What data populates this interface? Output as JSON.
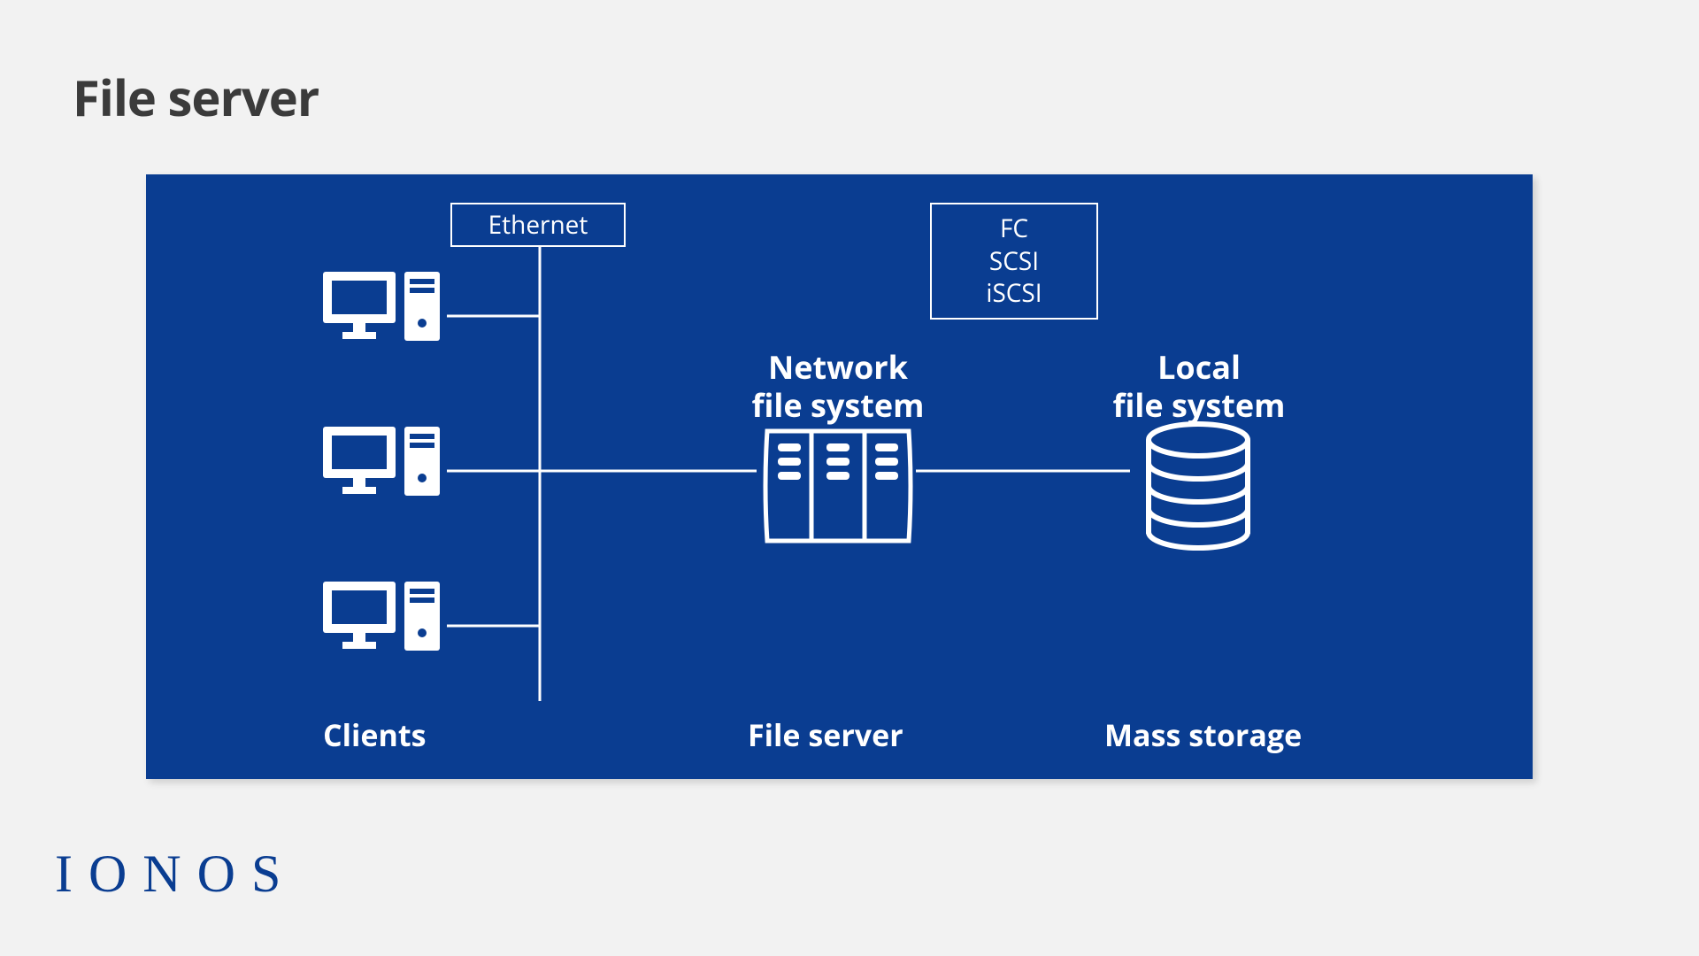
{
  "title": "File server",
  "connections": {
    "client_network_label": "Ethernet",
    "storage_protocols": [
      "FC",
      "SCSI",
      "iSCSI"
    ]
  },
  "nodes": {
    "network_fs_label_line1": "Network",
    "network_fs_label_line2": "file system",
    "local_fs_label_line1": "Local",
    "local_fs_label_line2": "file system"
  },
  "sections": {
    "clients": "Clients",
    "server": "File server",
    "storage": "Mass storage"
  },
  "brand": "IONOS"
}
